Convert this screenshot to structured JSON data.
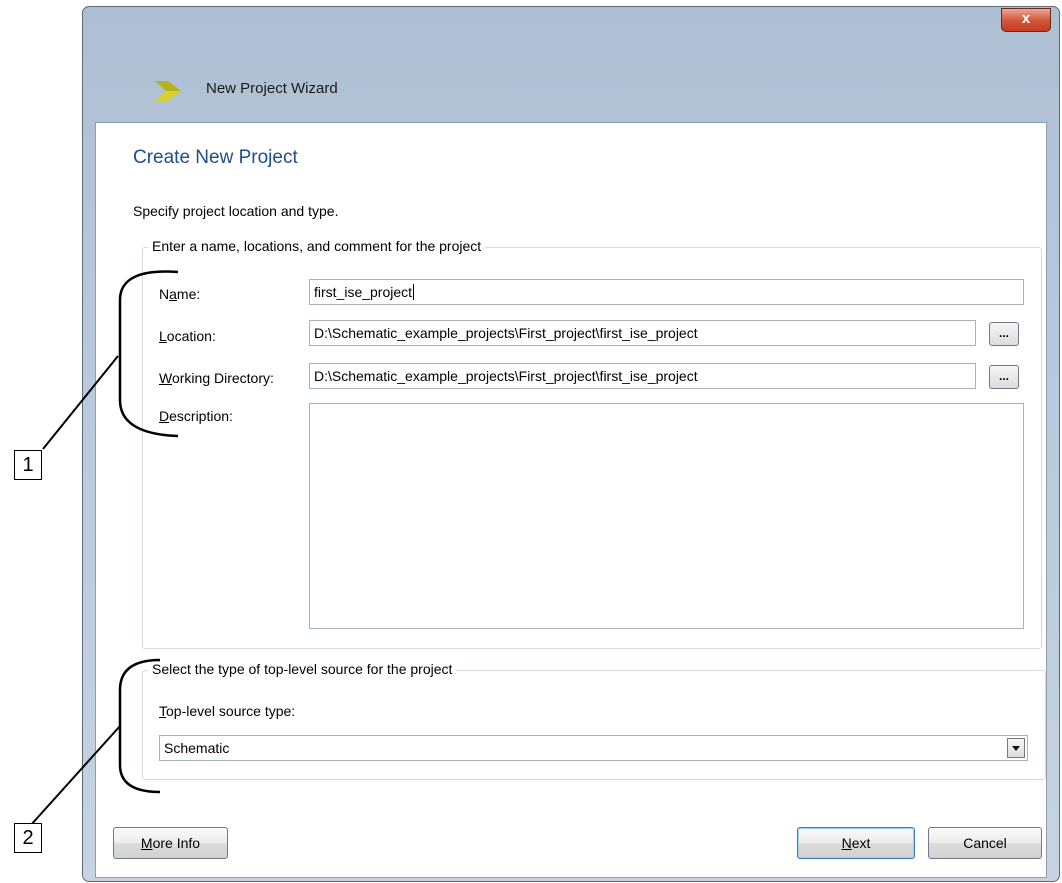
{
  "window": {
    "title": "New Project Wizard",
    "close_label": "x"
  },
  "page": {
    "title": "Create New Project",
    "subtitle": "Specify project location and type."
  },
  "project_group": {
    "legend": "Enter a name, locations, and comment for the project",
    "name_label_pre": "N",
    "name_label_ul": "a",
    "name_label_post": "me:",
    "name_value": "first_ise_project",
    "location_label_ul": "L",
    "location_label_post": "ocation:",
    "location_value": "D:\\Schematic_example_projects\\First_project\\first_ise_project",
    "workdir_label_ul": "W",
    "workdir_label_post": "orking Directory:",
    "workdir_value": "D:\\Schematic_example_projects\\First_project\\first_ise_project",
    "description_label_ul": "D",
    "description_label_post": "escription:",
    "browse_label": "..."
  },
  "source_group": {
    "legend": "Select the type of top-level source for the project",
    "type_label_ul": "T",
    "type_label_post": "op-level source type:",
    "type_value": "Schematic"
  },
  "buttons": {
    "more_info_ul": "M",
    "more_info_post": "ore Info",
    "next_ul": "N",
    "next_post": "ext",
    "cancel": "Cancel"
  },
  "annotations": {
    "callout_1": "1",
    "callout_2": "2"
  },
  "colors": {
    "accent_title": "#1e4e8c",
    "close_red": "#c23b1f",
    "logo_yellow": "#d6d12a"
  }
}
